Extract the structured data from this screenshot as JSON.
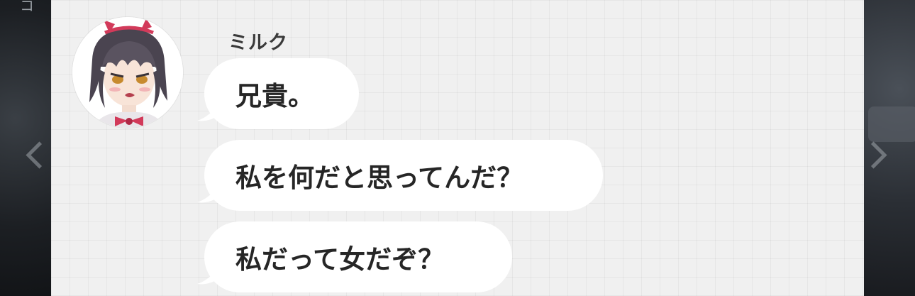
{
  "window": {
    "corner_glyph": "コ"
  },
  "navigation": {
    "prev_icon": "chevron-left-icon",
    "next_icon": "chevron-right-icon"
  },
  "chat": {
    "sender_name": "ミルク",
    "avatar_icon": "character-avatar",
    "messages": [
      {
        "text": "兄貴。"
      },
      {
        "text": "私を何だと思ってんだ？"
      },
      {
        "text": "私だって女だぞ？"
      }
    ]
  },
  "colors": {
    "panel_bg": "#f0f0f0",
    "bubble_bg": "#ffffff",
    "text": "#262626",
    "sender_text": "#3a3a3a",
    "avatar_accent": "#d23a5a"
  }
}
